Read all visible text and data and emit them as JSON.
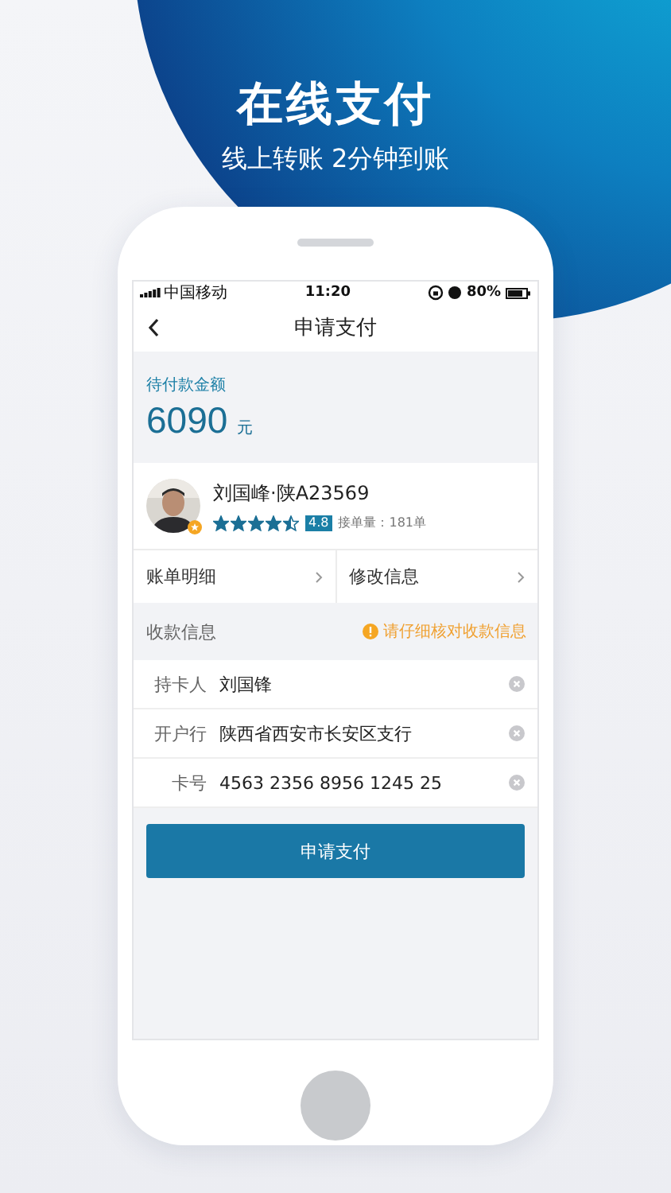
{
  "headline": {
    "title": "在线支付",
    "subtitle": "线上转账 2分钟到账"
  },
  "status_bar": {
    "carrier": "中国移动",
    "time": "11:20",
    "battery": "80%"
  },
  "nav": {
    "title": "申请支付"
  },
  "amount": {
    "label": "待付款金额",
    "value": "6090",
    "unit": "元"
  },
  "driver": {
    "name": "刘国峰·陕A23569",
    "stars": 4.5,
    "rating": "4.8",
    "orders": "接单量：181单"
  },
  "actions": [
    {
      "label": "账单明细"
    },
    {
      "label": "修改信息"
    }
  ],
  "payee": {
    "title": "收款信息",
    "warning": "请仔细核对收款信息",
    "fields": [
      {
        "label": "持卡人",
        "value": "刘国锋"
      },
      {
        "label": "开户行",
        "value": "陕西省西安市长安区支行"
      },
      {
        "label": "卡号",
        "value": "4563 2356 8956 1245 25"
      }
    ]
  },
  "submit": "申请支付"
}
